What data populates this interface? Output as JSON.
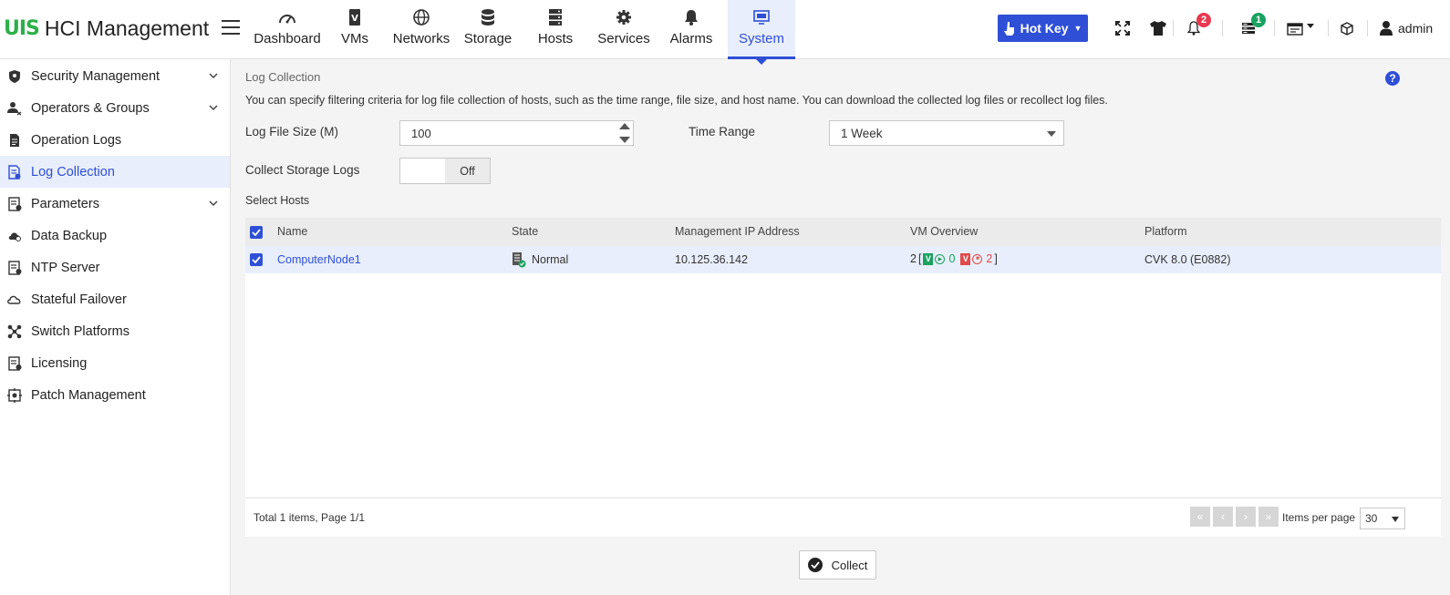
{
  "app": {
    "logo_mark": "UIS",
    "title": "HCI Management"
  },
  "nav": {
    "items": [
      {
        "label": "Dashboard",
        "icon": "speedometer-icon"
      },
      {
        "label": "VMs",
        "icon": "vm-icon"
      },
      {
        "label": "Networks",
        "icon": "globe-icon"
      },
      {
        "label": "Storage",
        "icon": "database-icon"
      },
      {
        "label": "Hosts",
        "icon": "server-icon"
      },
      {
        "label": "Services",
        "icon": "gear-icon"
      },
      {
        "label": "Alarms",
        "icon": "bell-icon"
      },
      {
        "label": "System",
        "icon": "monitor-icon"
      }
    ],
    "active": "System"
  },
  "toolbar": {
    "hotkey_label": "Hot Key",
    "notification_count": "2",
    "task_count": "1",
    "user_name": "admin"
  },
  "sidebar": {
    "items": [
      {
        "label": "Security Management",
        "icon": "shield-icon",
        "expandable": true
      },
      {
        "label": "Operators & Groups",
        "icon": "users-icon",
        "expandable": true
      },
      {
        "label": "Operation Logs",
        "icon": "document-icon",
        "expandable": false
      },
      {
        "label": "Log Collection",
        "icon": "log-collection-icon",
        "expandable": false
      },
      {
        "label": "Parameters",
        "icon": "parameters-icon",
        "expandable": true
      },
      {
        "label": "Data Backup",
        "icon": "cloud-backup-icon",
        "expandable": false
      },
      {
        "label": "NTP Server",
        "icon": "ntp-icon",
        "expandable": false
      },
      {
        "label": "Stateful Failover",
        "icon": "failover-icon",
        "expandable": false
      },
      {
        "label": "Switch Platforms",
        "icon": "switch-platforms-icon",
        "expandable": false
      },
      {
        "label": "Licensing",
        "icon": "license-icon",
        "expandable": false
      },
      {
        "label": "Patch Management",
        "icon": "patch-icon",
        "expandable": false
      }
    ],
    "active": "Log Collection"
  },
  "main": {
    "breadcrumb": "Log Collection",
    "description": "You can specify filtering criteria for log file collection of hosts, such as the time range, file size, and host name. You can download the collected log files or recollect log files.",
    "log_file_size_label": "Log File Size (M)",
    "log_file_size_value": "100",
    "time_range_label": "Time Range",
    "time_range_value": "1 Week",
    "collect_storage_label": "Collect Storage Logs",
    "collect_storage_value": "Off",
    "select_hosts_label": "Select Hosts",
    "collect_button": "Collect"
  },
  "table": {
    "columns": [
      "Name",
      "State",
      "Management IP Address",
      "VM Overview",
      "Platform"
    ],
    "rows": [
      {
        "name": "ComputerNode1",
        "state": "Normal",
        "ip": "10.125.36.142",
        "vm_total": "2",
        "vm_running": "0",
        "vm_stopped": "2",
        "platform": "CVK 8.0 (E0882)",
        "checked": true
      }
    ],
    "total_text": "Total 1 items, Page 1/1",
    "items_per_page_label": "Items per page",
    "items_per_page_value": "30"
  },
  "colors": {
    "accent": "#2f4fd6",
    "brand_green": "#2db04a",
    "badge_red": "#e8384f",
    "badge_green": "#1aa260",
    "active_bg": "#e8eefb"
  }
}
